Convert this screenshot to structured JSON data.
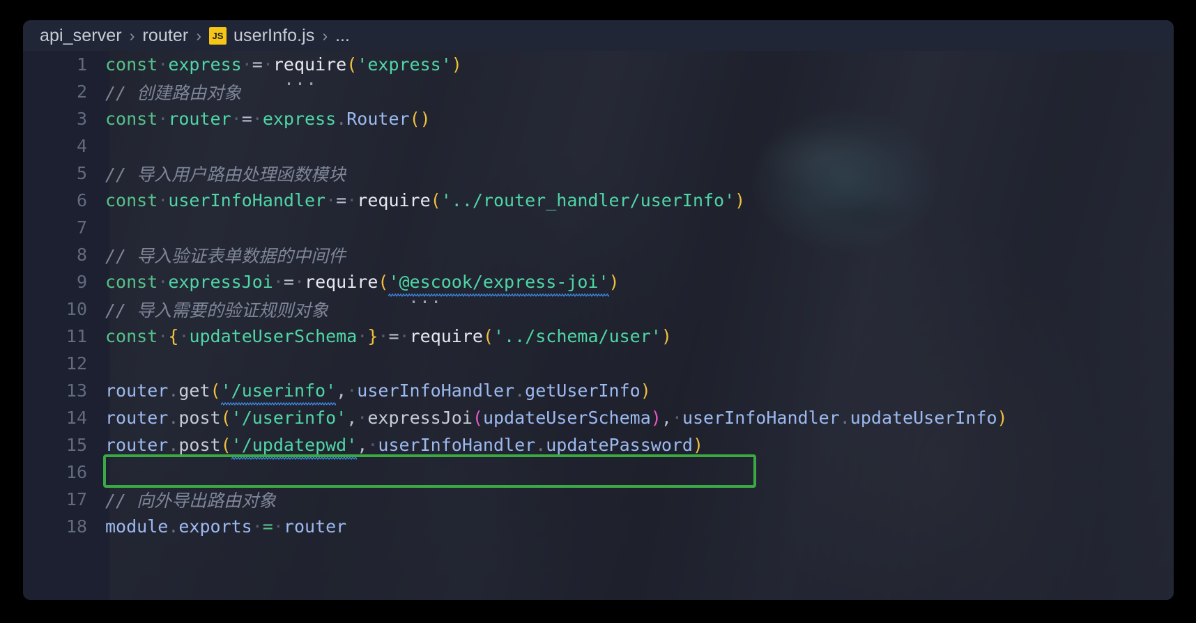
{
  "window": {
    "title": "userInfo.js",
    "background_color": "#000000",
    "panel_color": "#1f2330"
  },
  "breadcrumb": {
    "separator": "›",
    "ellipsis": "...",
    "items": [
      {
        "label": "api_server",
        "icon": null
      },
      {
        "label": "router",
        "icon": null
      },
      {
        "label": "userInfo.js",
        "icon": "js-file-icon",
        "icon_text": "JS",
        "icon_color": "#f5c518"
      }
    ]
  },
  "editor": {
    "language": "javascript",
    "highlight": {
      "color": "#3aa843",
      "line": 15,
      "note": "green rectangle annotation around line 15"
    },
    "line_numbers": [
      1,
      2,
      3,
      4,
      5,
      6,
      7,
      8,
      9,
      10,
      11,
      12,
      13,
      14,
      15,
      16,
      17,
      18
    ],
    "lines": [
      {
        "n": 1,
        "text": "const express = require('express')"
      },
      {
        "n": 2,
        "text": "// 创建路由对象"
      },
      {
        "n": 3,
        "text": "const router = express.Router()"
      },
      {
        "n": 4,
        "text": ""
      },
      {
        "n": 5,
        "text": "// 导入用户路由处理函数模块"
      },
      {
        "n": 6,
        "text": "const userInfoHandler = require('../router_handler/userInfo')"
      },
      {
        "n": 7,
        "text": ""
      },
      {
        "n": 8,
        "text": "// 导入验证表单数据的中间件"
      },
      {
        "n": 9,
        "text": "const expressJoi = require('@escook/express-joi')"
      },
      {
        "n": 10,
        "text": "// 导入需要的验证规则对象"
      },
      {
        "n": 11,
        "text": "const { updateUserSchema } = require('../schema/user')"
      },
      {
        "n": 12,
        "text": ""
      },
      {
        "n": 13,
        "text": "router.get('/userinfo', userInfoHandler.getUserInfo)"
      },
      {
        "n": 14,
        "text": "router.post('/userinfo', expressJoi(updateUserSchema), userInfoHandler.updateUserInfo)"
      },
      {
        "n": 15,
        "text": "router.post('/updatepwd', userInfoHandler.updatePassword)"
      },
      {
        "n": 16,
        "text": ""
      },
      {
        "n": 17,
        "text": "// 向外导出路由对象"
      },
      {
        "n": 18,
        "text": "module.exports = router"
      }
    ],
    "tokens": {
      "const": "const",
      "express_var": "express",
      "require": "require",
      "express_str": "'express'",
      "router_var": "router",
      "express_obj": "express",
      "Router_call": "Router",
      "userInfoHandler_var": "userInfoHandler",
      "router_handler_str": "'../router_handler/userInfo'",
      "expressJoi_var": "expressJoi",
      "escook_str": "'@escook/express-joi'",
      "updateUserSchema_var": "updateUserSchema",
      "schema_user_str": "'../schema/user'",
      "router_obj": "router",
      "get_method": "get",
      "post_method": "post",
      "userinfo_str": "'/userinfo'",
      "updatepwd_str": "'/updatepwd'",
      "handler_obj": "userInfoHandler",
      "getUserInfo": "getUserInfo",
      "updateUserInfo": "updateUserInfo",
      "updatePassword": "updatePassword",
      "expressJoi_call": "expressJoi",
      "updateUserSchema_arg": "updateUserSchema",
      "module_obj": "module",
      "exports_prop": "exports",
      "router_export": "router",
      "comment_2": "// 创建路由对象",
      "comment_5": "// 导入用户路由处理函数模块",
      "comment_8": "// 导入验证表单数据的中间件",
      "comment_10": "// 导入需要的验证规则对象",
      "comment_17": "// 向外导出路由对象",
      "codelens_dots": "..."
    },
    "colors": {
      "keyword": "#56c289",
      "variable": "#4fd6a6",
      "string": "#4fd6a6",
      "function": "#e6e9f0",
      "property": "#9cb9f0",
      "comment": "#7f8699",
      "bracket_yellow": "#f2c13d",
      "bracket_magenta": "#e857c6",
      "operator": "#b8c0d0",
      "line_number": "#636b80",
      "squiggle": "#3d8ae8"
    }
  }
}
